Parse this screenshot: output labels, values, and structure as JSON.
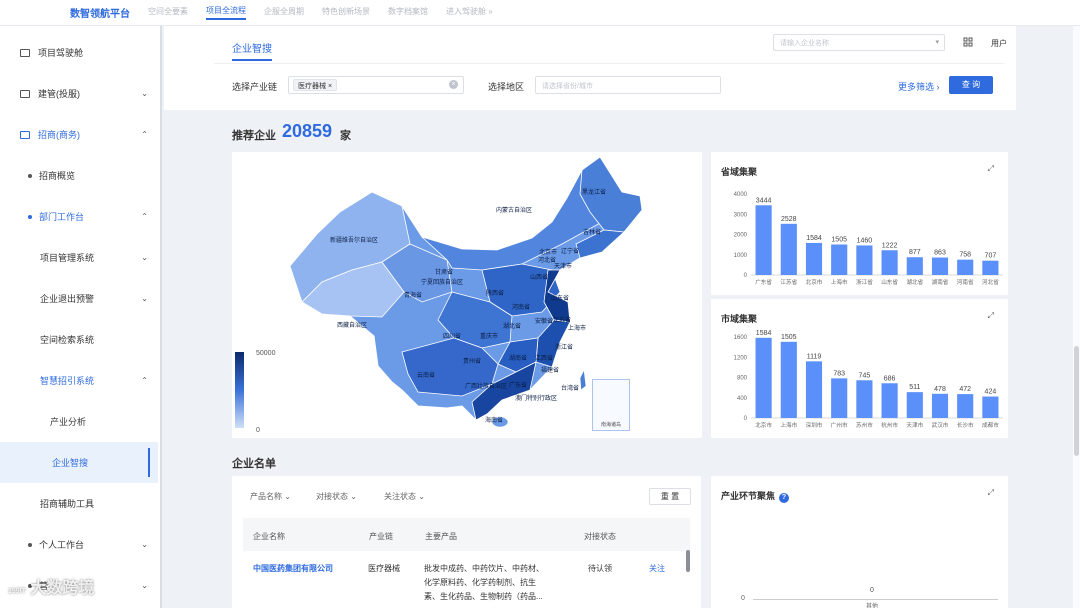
{
  "topnav": {
    "logo": "数智领航平台",
    "tabs": [
      "空间全要素",
      "项目全流程",
      "企服全周期",
      "特色创新场景",
      "数字档案馆",
      "进入驾驶舱 »"
    ],
    "active_index": 1
  },
  "sidebar": {
    "items": [
      {
        "label": "项目驾驶舱"
      },
      {
        "label": "建管(投服)",
        "chevron": "⌄"
      },
      {
        "label": "招商(商务)",
        "chevron": "⌃"
      },
      {
        "label": "招商概览"
      },
      {
        "label": "部门工作台",
        "chevron": "⌃"
      },
      {
        "label": "项目管理系统",
        "chevron": "⌄"
      },
      {
        "label": "企业退出预警",
        "chevron": "⌄"
      },
      {
        "label": "空间检索系统"
      },
      {
        "label": "智慧招引系统",
        "chevron": "⌃"
      },
      {
        "label": "产业分析"
      },
      {
        "label": "企业智搜"
      },
      {
        "label": "招商辅助工具"
      },
      {
        "label": "个人工作台",
        "chevron": "⌄"
      },
      {
        "label": "营",
        "chevron": "⌄"
      }
    ]
  },
  "header": {
    "tab": "企业智搜",
    "company_search_placeholder": "请输入企业名称",
    "user": "用户",
    "industry_label": "选择产业链",
    "industry_tag": "医疗器械 ×",
    "region_label": "选择地区",
    "region_placeholder": "请选择省份/城市",
    "more_filters": "更多筛选 ›",
    "query_button": "查 询"
  },
  "recommend": {
    "title": "推荐企业",
    "count": "20859",
    "unit": "家",
    "legend_max": "50000",
    "legend_min": "0",
    "south_sea_label": "南海诸岛"
  },
  "map_labels": [
    "黑龙江省",
    "吉林省",
    "辽宁省",
    "内蒙古自治区",
    "新疆维吾尔自治区",
    "甘肃省",
    "宁夏回族自治区",
    "山西省",
    "陕西省",
    "河北省",
    "北京市",
    "天津市",
    "山东省",
    "河南省",
    "江苏省",
    "安徽省",
    "上海市",
    "青海省",
    "西藏自治区",
    "四川省",
    "重庆市",
    "湖北省",
    "浙江省",
    "湖南省",
    "江西省",
    "贵州省",
    "云南省",
    "福建省",
    "广西壮族自治区",
    "广东省",
    "台湾省",
    "海南省",
    "澳门特别行政区"
  ],
  "province_chart": {
    "title": "省域集聚",
    "chart_data": {
      "type": "bar",
      "categories": [
        "广东省",
        "江苏省",
        "北京市",
        "上海市",
        "浙江省",
        "山东省",
        "湖北省",
        "湖南省",
        "河南省",
        "河北省"
      ],
      "values": [
        3444,
        2528,
        1584,
        1505,
        1460,
        1222,
        877,
        863,
        758,
        707
      ],
      "ylim": [
        0,
        4000
      ],
      "yticks": [
        0,
        1000,
        2000,
        3000,
        4000
      ],
      "color": "#5b8ff9"
    }
  },
  "city_chart": {
    "title": "市域集聚",
    "chart_data": {
      "type": "bar",
      "categories": [
        "北京市",
        "上海市",
        "深圳市",
        "广州市",
        "苏州市",
        "杭州市",
        "天津市",
        "武汉市",
        "长沙市",
        "成都市"
      ],
      "values": [
        1584,
        1505,
        1119,
        783,
        745,
        686,
        511,
        478,
        472,
        424
      ],
      "ylim": [
        0,
        1600
      ],
      "yticks": [
        0,
        400,
        800,
        1200,
        1600
      ],
      "color": "#5b8ff9"
    }
  },
  "company_list": {
    "title": "企业名单",
    "filters": [
      "产品名称 ⌄",
      "对接状态 ⌄",
      "关注状态 ⌄"
    ],
    "reset": "重 置",
    "columns": [
      "企业名称",
      "产业链",
      "主要产品",
      "对接状态"
    ],
    "rows": [
      {
        "name": "中国医药集团有限公司",
        "chain": "医疗器械",
        "products": [
          "批发中成药、中药饮片、中药材、",
          "化学原料药、化学药制剂、抗生",
          "素、生化药品、生物制药（药品..."
        ],
        "status": "待认领",
        "action": "关注"
      }
    ]
  },
  "industry_card": {
    "title": "产业环节聚焦",
    "help": "?",
    "y_zero": "0",
    "value_label": "0",
    "x_label": "其他"
  },
  "watermark": {
    "sub": "199IT",
    "text": "大数跨境"
  }
}
